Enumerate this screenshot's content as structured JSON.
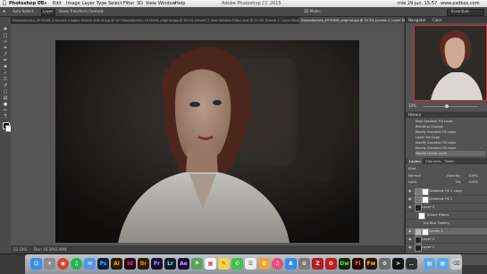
{
  "menubar": {
    "app": "Photoshop CC",
    "items": [
      "File",
      "Edit",
      "Image",
      "Layer",
      "Type",
      "Select",
      "Filter",
      "3D",
      "View",
      "Window",
      "Help"
    ],
    "window_title": "Adobe Photoshop CC 2015",
    "clock": "mié 29 jun. 15:57",
    "user": "www.psdbox.com"
  },
  "options": {
    "auto_select": "Auto-Select:",
    "layer_select": "Layer",
    "show_transform": "Show Transform Controls",
    "mode_label": "3D Mode:",
    "workspace": "Essentials"
  },
  "tabs": [
    "Dispositphoto_4978458 [Concept: images restore side-of.jpg @ 100% (Layer 1, RGB/8)",
    "Dispositphoto_4978458_original.jpg @ 33.3% (Levels 1, Layer Mask/8)",
    "New Window Effect.psd @ 33.3% (Levels 1, Layer Mask/8)",
    "Dispositphoto_4978458_original.jpg @ 33.3% (Levels 1, Layer Mask/8)"
  ],
  "status": {
    "zoom": "33.33%",
    "doc": "Doc: 16.1M/2.99M"
  },
  "panels": {
    "navigator": "Navigator",
    "color": "Color",
    "zoom": "33%",
    "history": "History",
    "history_items": [
      "New Gradient Fill Layer",
      "Blending Change",
      "Modify Gradient Fill Layer",
      "Layer Via Copy",
      "Modify Gradient Fill Layer",
      "Modify Gradient Fill Layer",
      "Modify Levels Layer"
    ],
    "layers_tabs": [
      "Layers",
      "Channels",
      "Paths"
    ],
    "kind": "Kind",
    "blend": "Normal",
    "opacity_label": "Opacity:",
    "opacity": "100%",
    "lock_label": "Lock:",
    "fill_label": "Fill:",
    "fill": "100%",
    "layers": [
      "Gradient Fill 1 copy",
      "Gradient Fill 1",
      "Layer 3",
      "Smart Filters",
      "Iris Blur Gallery",
      "Levels 1",
      "Layer 2",
      "Layer 1"
    ]
  },
  "dock": {
    "icons": [
      "finder-icon",
      "launchpad-icon",
      "chrome-icon",
      "spotify-icon",
      "mail-icon",
      "photoshop-icon",
      "illustrator-icon",
      "indesign-icon",
      "bridge-icon",
      "premiere-icon",
      "lightroom-icon",
      "aftereffects-icon",
      "maps-icon",
      "calendar-icon",
      "notes-icon",
      "messages-icon",
      "reminders-icon",
      "photos-icon",
      "itunes-icon",
      "appstore-icon",
      "preferences-icon",
      "filezilla-icon",
      "acrobat-icon",
      "dreamweaver-icon",
      "flash-icon",
      "fireworks-icon",
      "automator-icon",
      "terminal-icon",
      "activity-icon",
      "folder-icon",
      "folder2-icon",
      "trash-icon"
    ],
    "labels": [
      "Ps",
      "Ai",
      "Id",
      "Br",
      "Pr",
      "Lr",
      "Ae",
      "Dw",
      "Fl",
      "Fw"
    ]
  }
}
